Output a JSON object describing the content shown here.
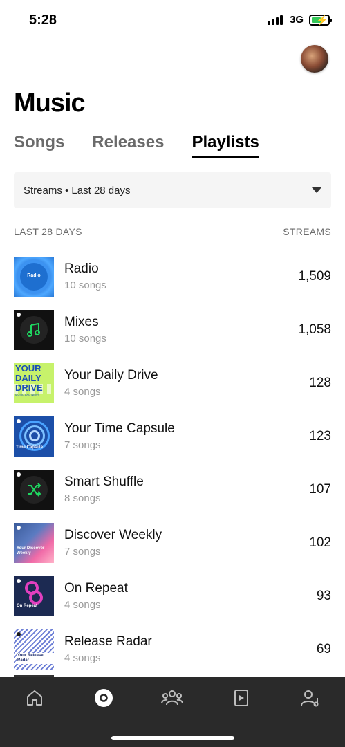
{
  "status": {
    "time": "5:28",
    "network": "3G"
  },
  "header": {
    "title": "Music"
  },
  "tabs": [
    {
      "label": "Songs",
      "active": false
    },
    {
      "label": "Releases",
      "active": false
    },
    {
      "label": "Playlists",
      "active": true
    }
  ],
  "filter": {
    "label": "Streams • Last 28 days"
  },
  "list_header": {
    "left": "LAST 28 DAYS",
    "right": "STREAMS"
  },
  "playlists": [
    {
      "title": "Radio",
      "subtitle": "10 songs",
      "streams": "1,509",
      "cover_text": "Radio"
    },
    {
      "title": "Mixes",
      "subtitle": "10 songs",
      "streams": "1,058",
      "cover_text": ""
    },
    {
      "title": "Your Daily Drive",
      "subtitle": "4 songs",
      "streams": "128",
      "cover_text": "YOUR DAILY DRIVE",
      "cover_sub": "MUSIC AND NEWS"
    },
    {
      "title": "Your Time Capsule",
      "subtitle": "7 songs",
      "streams": "123",
      "cover_text": "Time Capsule"
    },
    {
      "title": "Smart Shuffle",
      "subtitle": "8 songs",
      "streams": "107",
      "cover_text": ""
    },
    {
      "title": "Discover Weekly",
      "subtitle": "7 songs",
      "streams": "102",
      "cover_text": "Your Discover Weekly"
    },
    {
      "title": "On Repeat",
      "subtitle": "4 songs",
      "streams": "93",
      "cover_text": "On Repeat"
    },
    {
      "title": "Release Radar",
      "subtitle": "4 songs",
      "streams": "69",
      "cover_text": "Your Release Radar"
    }
  ],
  "nav": [
    {
      "icon": "home-icon",
      "active": false
    },
    {
      "icon": "music-disc-icon",
      "active": true
    },
    {
      "icon": "audience-icon",
      "active": false
    },
    {
      "icon": "campaigns-icon",
      "active": false
    },
    {
      "icon": "profile-icon",
      "active": false
    }
  ],
  "colors": {
    "accent": "#000000",
    "nav_bg": "#2a2a2a",
    "battery": "#34c759"
  }
}
